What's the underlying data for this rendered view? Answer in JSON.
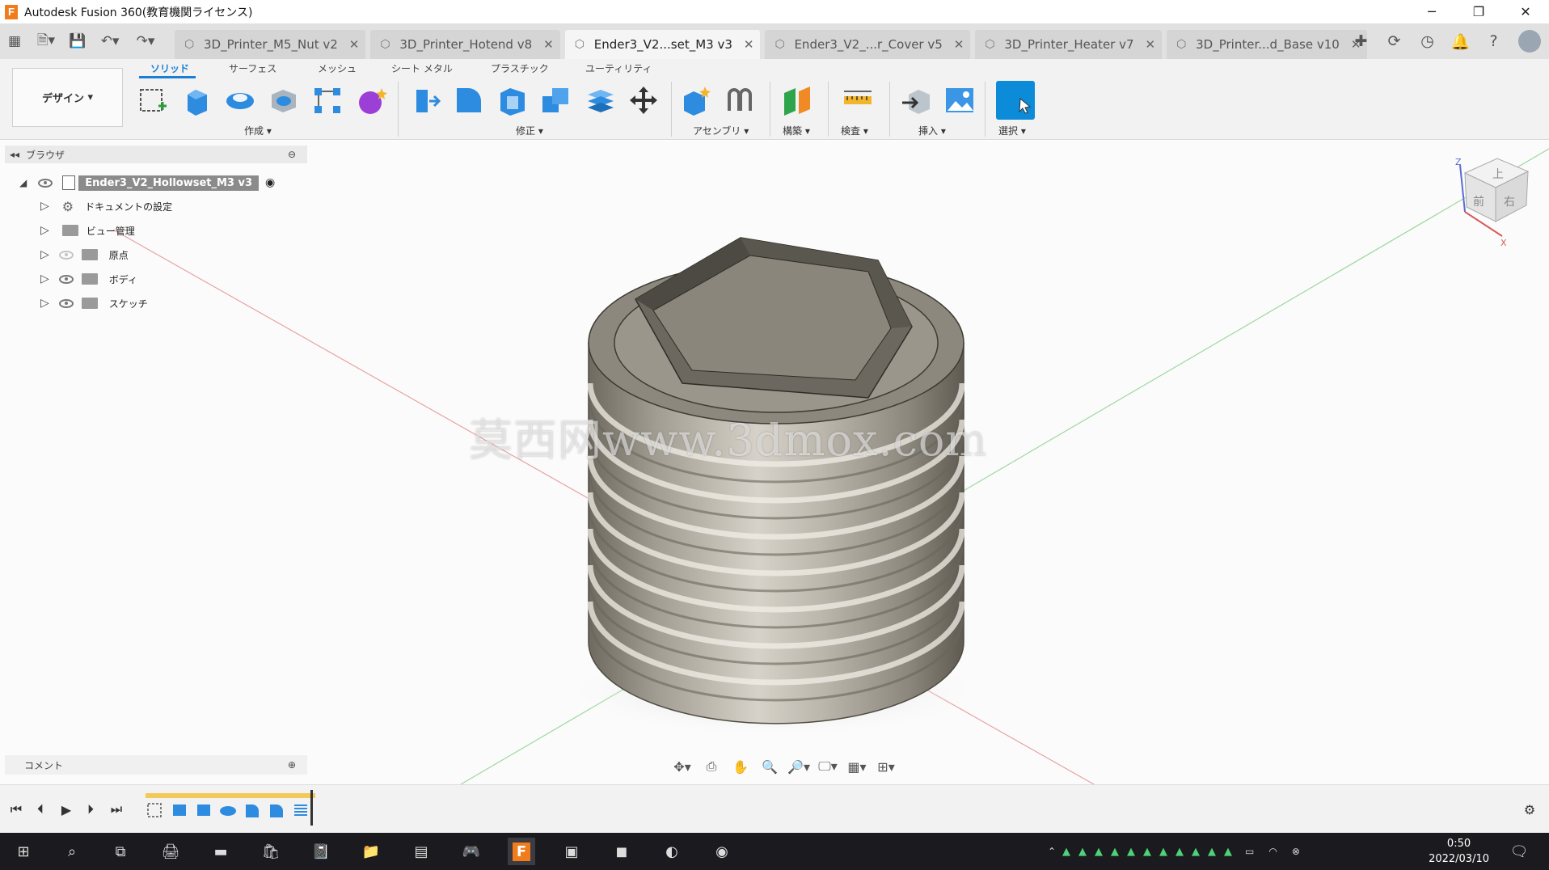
{
  "window": {
    "title": "Autodesk Fusion 360(教育機関ライセンス)",
    "logo_letter": "F"
  },
  "tabs": [
    {
      "label": "3D_Printer_M5_Nut v2",
      "active": false
    },
    {
      "label": "3D_Printer_Hotend v8",
      "active": false
    },
    {
      "label": "Ender3_V2...set_M3 v3",
      "active": true
    },
    {
      "label": "Ender3_V2_...r_Cover v5",
      "active": false
    },
    {
      "label": "3D_Printer_Heater v7",
      "active": false
    },
    {
      "label": "3D_Printer...d_Base v10",
      "active": false
    }
  ],
  "toolbar": {
    "workspace": "デザイン",
    "ribbon_tabs": [
      "ソリッド",
      "サーフェス",
      "メッシュ",
      "シート メタル",
      "プラスチック",
      "ユーティリティ"
    ],
    "groups": [
      "作成",
      "修正",
      "アセンブリ",
      "構築",
      "検査",
      "挿入",
      "選択"
    ]
  },
  "browser": {
    "title": "ブラウザ",
    "root": "Ender3_V2_Hollowset_M3 v3",
    "items": [
      "ドキュメントの設定",
      "ビュー管理",
      "原点",
      "ボディ",
      "スケッチ"
    ]
  },
  "viewcube": {
    "faces": [
      "上",
      "前",
      "右"
    ],
    "axes": [
      "Z",
      "X"
    ]
  },
  "watermark": "莫西网www.3dmox.com",
  "comments": {
    "label": "コメント"
  },
  "taskbar": {
    "time": "0:50",
    "date": "2022/03/10"
  },
  "colors": {
    "accent": "#1a7ed4",
    "timeline": "#f3c95a",
    "taskbar": "#1b1b1f"
  }
}
